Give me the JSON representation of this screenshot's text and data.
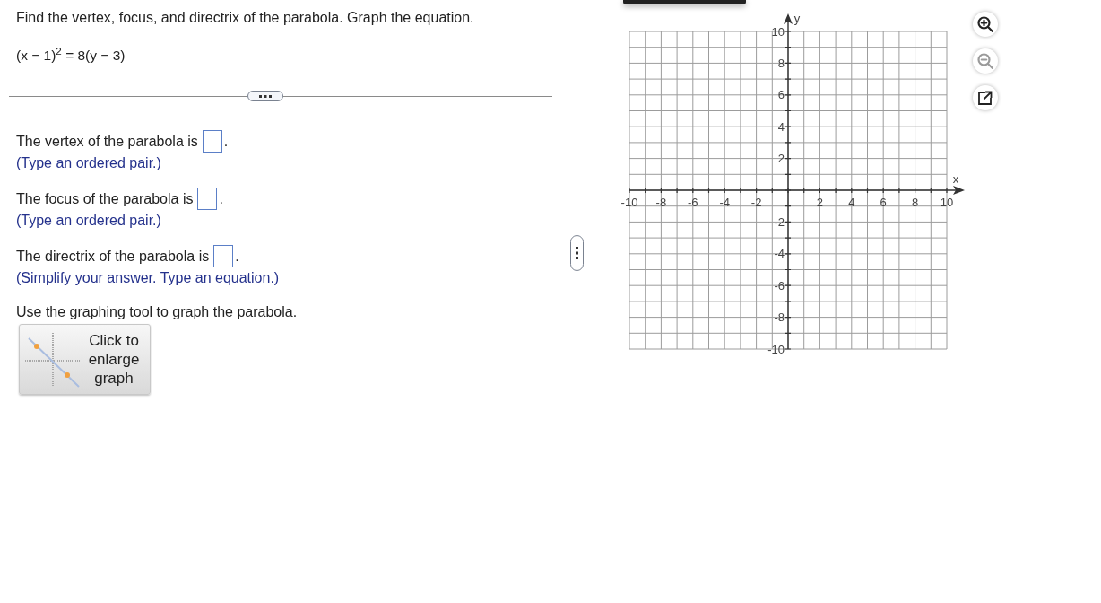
{
  "question": {
    "prompt": "Find the vertex, focus, and directrix of the parabola. Graph the equation.",
    "equation": "(x − 1)$^{2}$ = 8(y − 3)"
  },
  "answers": [
    {
      "label": "The vertex of the parabola is",
      "suffix": ".",
      "hint": "(Type an ordered pair.)"
    },
    {
      "label": "The focus of the parabola is",
      "suffix": ".",
      "hint": "(Type an ordered pair.)"
    },
    {
      "label": "The directrix of the parabola is",
      "suffix": ".",
      "hint": "(Simplify your answer. Type an equation.)"
    }
  ],
  "graph_instruction": "Use the graphing tool to graph the parabola.",
  "enlarge_button": {
    "label": "Click to enlarge graph"
  },
  "graph": {
    "x_label": "x",
    "y_label": "y",
    "x_tick_labels": [
      "-10",
      "-8",
      "-6",
      "-4",
      "-2",
      "2",
      "4",
      "6",
      "8",
      "10"
    ],
    "y_tick_labels": [
      "10",
      "8",
      "6",
      "4",
      "2",
      "-2",
      "-4",
      "-6",
      "-8",
      "-10"
    ]
  },
  "graph_tools": [
    {
      "kind": "zoom_in",
      "disabled": false
    },
    {
      "kind": "zoom_out",
      "disabled": true
    },
    {
      "kind": "popout",
      "disabled": false
    }
  ]
}
